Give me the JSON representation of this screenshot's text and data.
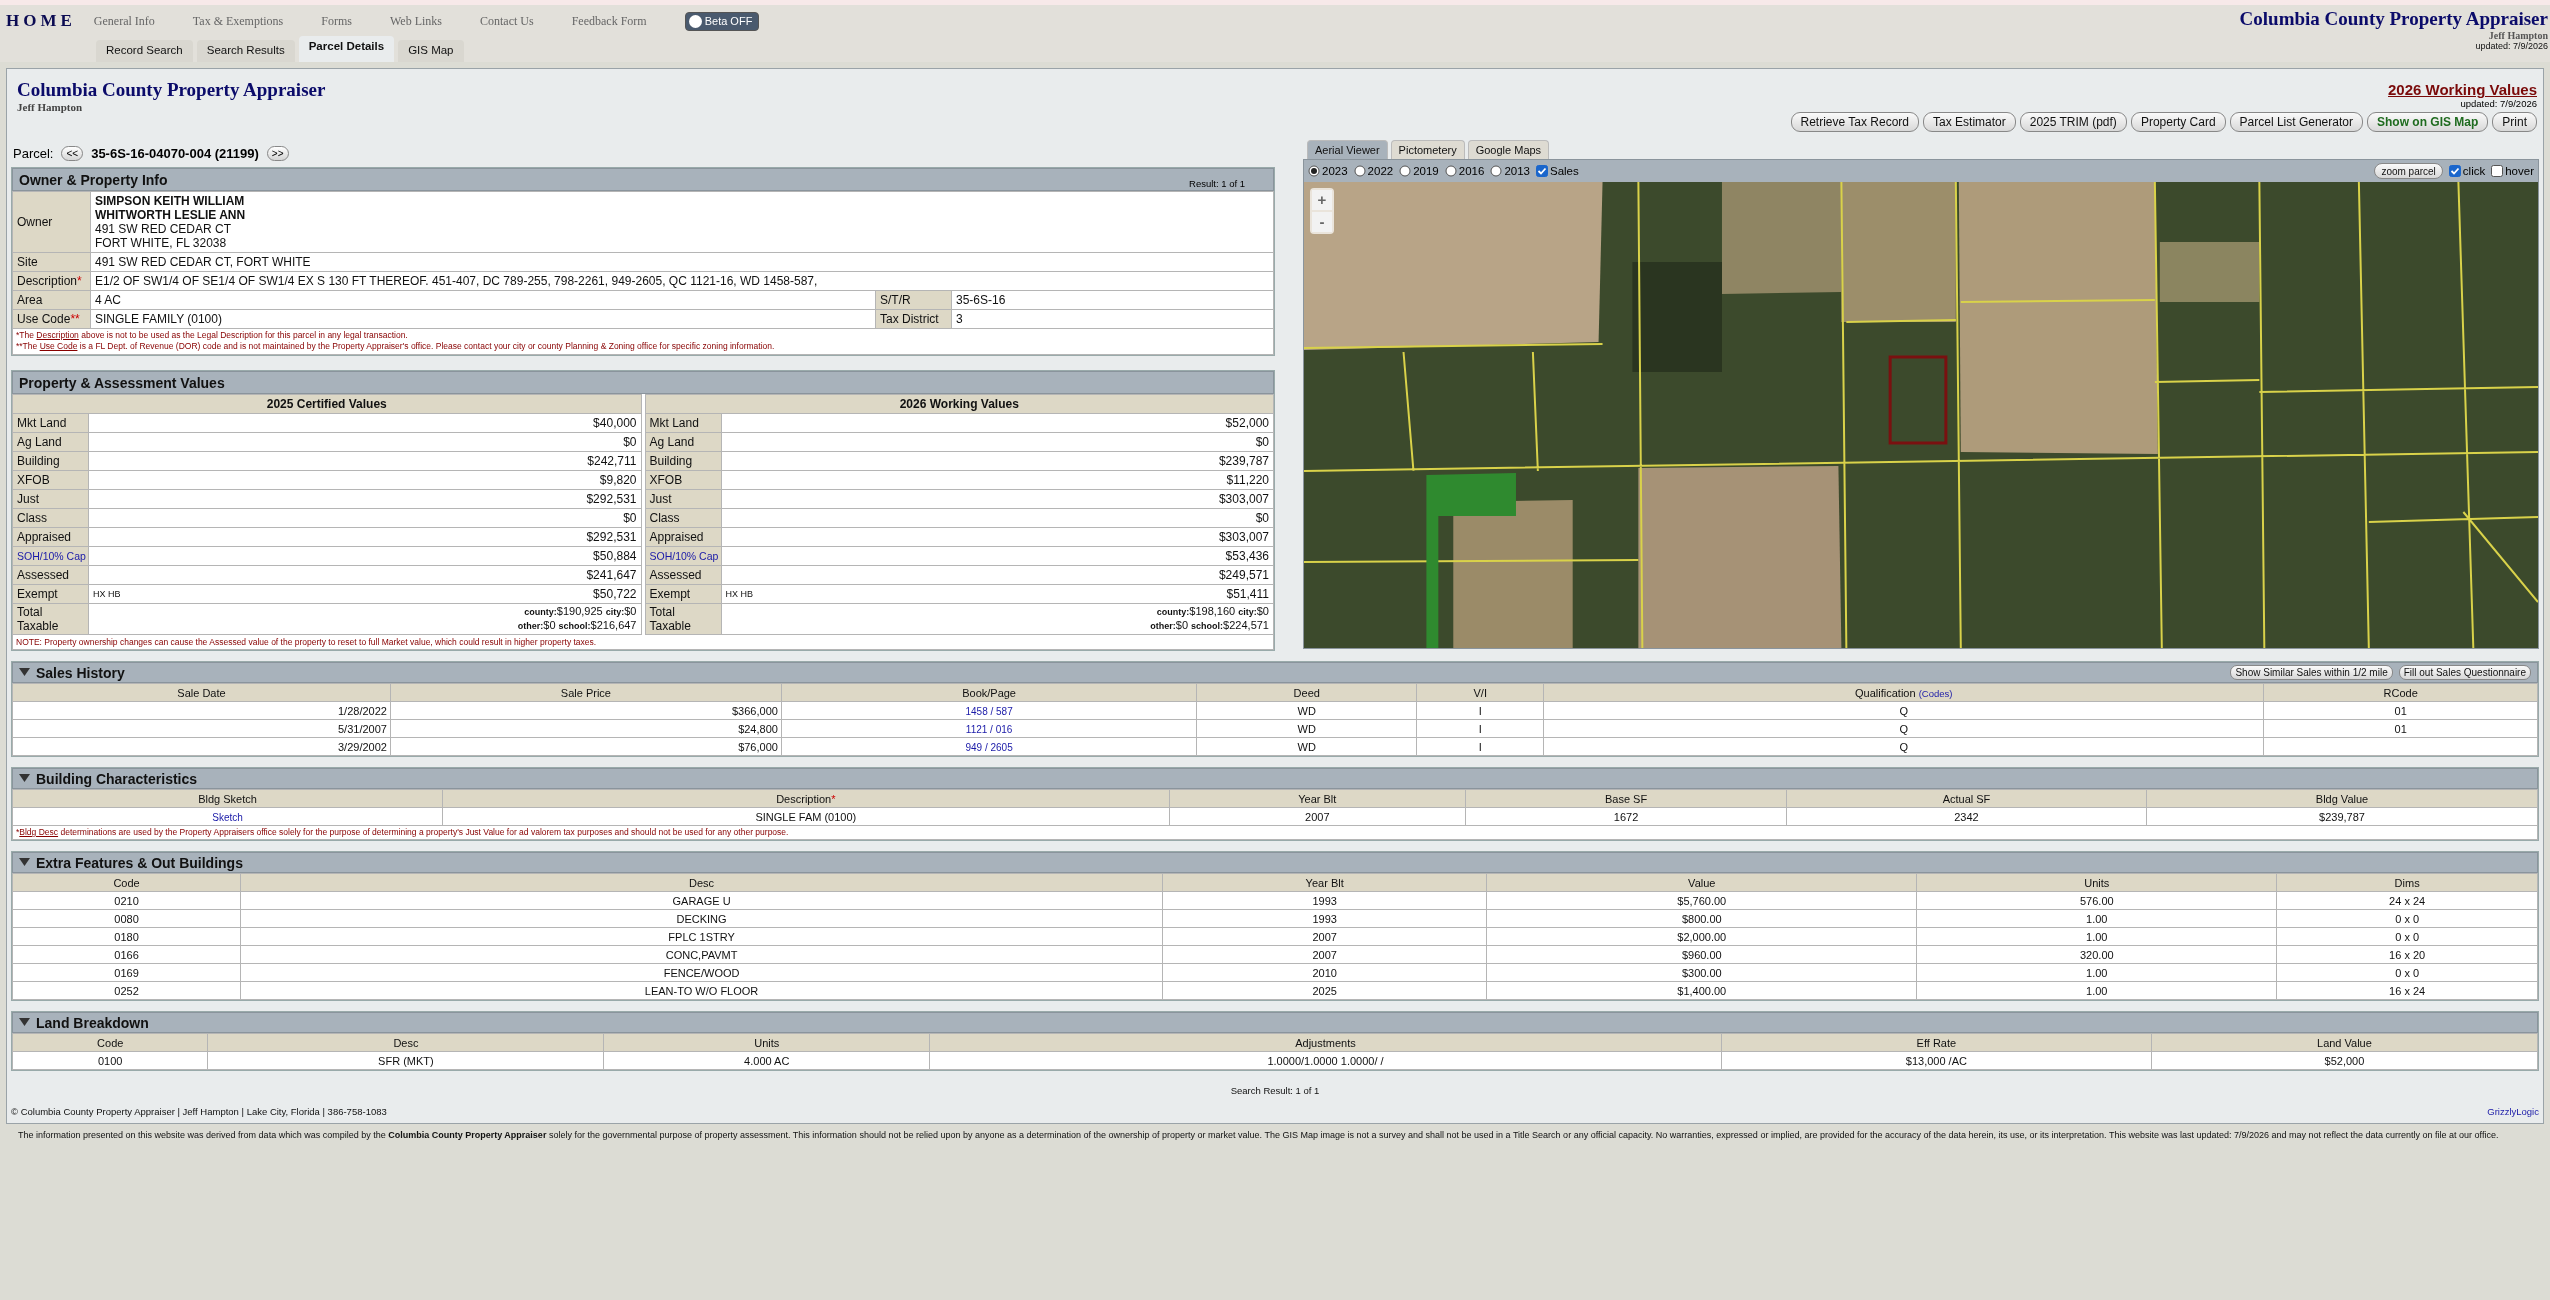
{
  "header": {
    "logo": "HOME",
    "nav": [
      "General Info",
      "Tax & Exemptions",
      "Forms",
      "Web Links",
      "Contact Us",
      "Feedback Form"
    ],
    "beta": {
      "label": "Beta OFF",
      "on": false
    },
    "tabs": [
      {
        "label": "Record Search",
        "selected": false
      },
      {
        "label": "Search Results",
        "selected": false
      },
      {
        "label": "Parcel Details",
        "selected": true
      },
      {
        "label": "GIS Map",
        "selected": false
      }
    ],
    "site_title": "Columbia County Property Appraiser",
    "site_subtitle": "Jeff Hampton",
    "updated": "updated: 7/9/2026"
  },
  "top": {
    "title": "Columbia County Property Appraiser",
    "subtitle": "Jeff Hampton",
    "working_values": "2026 Working Values",
    "updated": "updated: 7/9/2026",
    "buttons": [
      {
        "label": "Retrieve Tax Record",
        "kind": "normal"
      },
      {
        "label": "Tax Estimator",
        "kind": "normal"
      },
      {
        "label": "2025 TRIM (pdf)",
        "kind": "normal"
      },
      {
        "label": "Property Card",
        "kind": "normal"
      },
      {
        "label": "Parcel List Generator",
        "kind": "normal"
      },
      {
        "label": "Show on GIS Map",
        "kind": "gis"
      },
      {
        "label": "Print",
        "kind": "normal"
      }
    ]
  },
  "parcel": {
    "label": "Parcel:",
    "prev": "<<",
    "id": "35-6S-16-04070-004 (21199)",
    "next": ">>"
  },
  "owner_info": {
    "title": "Owner & Property Info",
    "result": "Result: 1 of 1",
    "owner": {
      "label": "Owner",
      "lines": [
        {
          "text": "SIMPSON KEITH WILLIAM",
          "bold": true
        },
        {
          "text": "WHITWORTH LESLIE ANN",
          "bold": true
        },
        {
          "text": "491 SW RED CEDAR CT",
          "bold": false
        },
        {
          "text": "FORT WHITE, FL 32038",
          "bold": false
        }
      ]
    },
    "rows": [
      [
        {
          "label": "Site",
          "value": "491 SW RED CEDAR CT, FORT WHITE"
        }
      ],
      [
        {
          "label": "Description",
          "mark": "*",
          "value": "E1/2 OF SW1/4 OF SE1/4 OF SW1/4 EX S 130 FT THEREOF. 451-407, DC 789-255, 798-2261, 949-2605, QC 1121-16, WD 1458-587,"
        }
      ],
      [
        {
          "label": "Area",
          "value": "4 AC"
        },
        {
          "label": "S/T/R",
          "value": "35-6S-16"
        }
      ],
      [
        {
          "label": "Use Code",
          "mark": "**",
          "value": "SINGLE FAMILY (0100)"
        },
        {
          "label": "Tax District",
          "value": "3"
        }
      ]
    ],
    "notes": [
      {
        "before": "*The ",
        "link": "Description",
        "after": " above is not to be used as the Legal Description for this parcel in any legal transaction."
      },
      {
        "before": "**The ",
        "link": "Use Code",
        "after": " is a FL Dept. of Revenue (DOR) code and is not maintained by the Property Appraiser's office. Please contact your city or county Planning & Zoning office for specific zoning information."
      }
    ]
  },
  "assessment": {
    "title": "Property & Assessment Values",
    "tables": [
      {
        "title": "2025 Certified Values",
        "rows": [
          {
            "label": "Mkt Land",
            "value": "$40,000"
          },
          {
            "label": "Ag Land",
            "value": "$0"
          },
          {
            "label": "Building",
            "value": "$242,711"
          },
          {
            "label": "XFOB",
            "value": "$9,820"
          },
          {
            "label": "Just",
            "value": "$292,531"
          },
          {
            "label": "Class",
            "value": "$0"
          },
          {
            "label": "Appraised",
            "value": "$292,531"
          },
          {
            "label": "SOH/10% Cap",
            "link": true,
            "value": "$50,884"
          },
          {
            "label": "Assessed",
            "value": "$241,647"
          },
          {
            "label": "Exempt",
            "note": "HX HB",
            "value": "$50,722"
          },
          {
            "label": "Total Taxable",
            "lines": [
              "**county:**$190,925 **city:**$0",
              "**other:**$0 **school:**$216,647"
            ]
          }
        ]
      },
      {
        "title": "2026 Working Values",
        "rows": [
          {
            "label": "Mkt Land",
            "value": "$52,000"
          },
          {
            "label": "Ag Land",
            "value": "$0"
          },
          {
            "label": "Building",
            "value": "$239,787"
          },
          {
            "label": "XFOB",
            "value": "$11,220"
          },
          {
            "label": "Just",
            "value": "$303,007"
          },
          {
            "label": "Class",
            "value": "$0"
          },
          {
            "label": "Appraised",
            "value": "$303,007"
          },
          {
            "label": "SOH/10% Cap",
            "link": true,
            "value": "$53,436"
          },
          {
            "label": "Assessed",
            "value": "$249,571"
          },
          {
            "label": "Exempt",
            "note": "HX HB",
            "value": "$51,411"
          },
          {
            "label": "Total Taxable",
            "lines": [
              "**county:**$198,160 **city:**$0",
              "**other:**$0 **school:**$224,571"
            ]
          }
        ]
      }
    ],
    "note": "NOTE: Property ownership changes can cause the Assessed value of the property to reset to full Market value, which could result in higher property taxes."
  },
  "map": {
    "tabs": [
      {
        "label": "Aerial Viewer",
        "selected": true
      },
      {
        "label": "Pictometery",
        "selected": false
      },
      {
        "label": "Google Maps",
        "selected": false
      }
    ],
    "years": [
      {
        "label": "2023",
        "selected": true
      },
      {
        "label": "2022",
        "selected": false
      },
      {
        "label": "2019",
        "selected": false
      },
      {
        "label": "2016",
        "selected": false
      },
      {
        "label": "2013",
        "selected": false
      }
    ],
    "layers": [
      {
        "label": "Sales",
        "checked": true
      }
    ],
    "zoom_parcel": "zoom parcel",
    "modes": [
      {
        "label": "click",
        "checked": true
      },
      {
        "label": "hover",
        "checked": false
      }
    ],
    "zoom_in": "+",
    "zoom_out": "-"
  },
  "sales_history": {
    "title": "Sales History",
    "expanded": true,
    "buttons": [
      "Show Similar Sales within 1/2 mile",
      "Fill out Sales Questionnaire"
    ],
    "columns": [
      {
        "label": "Sale Date"
      },
      {
        "label": "Sale Price"
      },
      {
        "label": "Book/Page"
      },
      {
        "label": "Deed"
      },
      {
        "label": "V/I"
      },
      {
        "label": "Qualification",
        "link": "(Codes)"
      },
      {
        "label": "RCode"
      }
    ],
    "rows": [
      [
        "1/28/2022",
        "$366,000",
        {
          "text": "1458 / 587",
          "link": true
        },
        "WD",
        "I",
        "Q",
        "01"
      ],
      [
        "5/31/2007",
        "$24,800",
        {
          "text": "1121 / 016",
          "link": true
        },
        "WD",
        "I",
        "Q",
        "01"
      ],
      [
        "3/29/2002",
        "$76,000",
        {
          "text": "949 / 2605",
          "link": true
        },
        "WD",
        "I",
        "Q",
        ""
      ]
    ]
  },
  "building": {
    "title": "Building Characteristics",
    "expanded": true,
    "columns": [
      {
        "label": "Bldg Sketch"
      },
      {
        "label": "Description",
        "mark": "*"
      },
      {
        "label": "Year Blt"
      },
      {
        "label": "Base SF"
      },
      {
        "label": "Actual SF"
      },
      {
        "label": "Bldg Value"
      }
    ],
    "rows": [
      [
        {
          "text": "Sketch",
          "link": true
        },
        "SINGLE FAM (0100)",
        "2007",
        "1672",
        "2342",
        "$239,787"
      ]
    ],
    "note": {
      "before": "*",
      "link": "Bldg Desc",
      "after": " determinations are used by the Property Appraisers office solely for the purpose of determining a property's Just Value for ad valorem tax purposes and should not be used for any other purpose."
    }
  },
  "extra_features": {
    "title": "Extra Features & Out Buildings",
    "expanded": true,
    "columns": [
      {
        "label": "Code"
      },
      {
        "label": "Desc"
      },
      {
        "label": "Year Blt"
      },
      {
        "label": "Value"
      },
      {
        "label": "Units"
      },
      {
        "label": "Dims"
      }
    ],
    "rows": [
      [
        "0210",
        "GARAGE U",
        "1993",
        "$5,760.00",
        "576.00",
        "24 x 24"
      ],
      [
        "0080",
        "DECKING",
        "1993",
        "$800.00",
        "1.00",
        "0 x 0"
      ],
      [
        "0180",
        "FPLC 1STRY",
        "2007",
        "$2,000.00",
        "1.00",
        "0 x 0"
      ],
      [
        "0166",
        "CONC,PAVMT",
        "2007",
        "$960.00",
        "320.00",
        "16 x 20"
      ],
      [
        "0169",
        "FENCE/WOOD",
        "2010",
        "$300.00",
        "1.00",
        "0 x 0"
      ],
      [
        "0252",
        "LEAN-TO W/O FLOOR",
        "2025",
        "$1,400.00",
        "1.00",
        "16 x 24"
      ]
    ]
  },
  "land": {
    "title": "Land Breakdown",
    "expanded": true,
    "columns": [
      {
        "label": "Code"
      },
      {
        "label": "Desc"
      },
      {
        "label": "Units"
      },
      {
        "label": "Adjustments"
      },
      {
        "label": "Eff Rate"
      },
      {
        "label": "Land Value"
      }
    ],
    "rows": [
      [
        "0100",
        "SFR (MKT)",
        "4.000 AC",
        "1.0000/1.0000 1.0000/ /",
        "$13,000 /AC",
        "$52,000"
      ]
    ]
  },
  "footer": {
    "search_result": "Search Result: 1 of 1",
    "copyright": "© Columbia County Property Appraiser | Jeff Hampton | Lake City, Florida | 386-758-1083",
    "credit": "GrizzlyLogic",
    "disclaimer": "The information presented on this website was derived from data which was compiled by the **Columbia County Property Appraiser** solely for the governmental purpose of property assessment. This information should not be relied upon by anyone as a determination of the ownership of property or market value. The GIS Map image is not a survey and shall not be used in a Title Search or any official capacity. No warranties, expressed or implied, are provided for the accuracy of the data herein, its use, or its interpretation. This website was last updated: 7/9/2026 and may not reflect the data currently on file at our office."
  }
}
